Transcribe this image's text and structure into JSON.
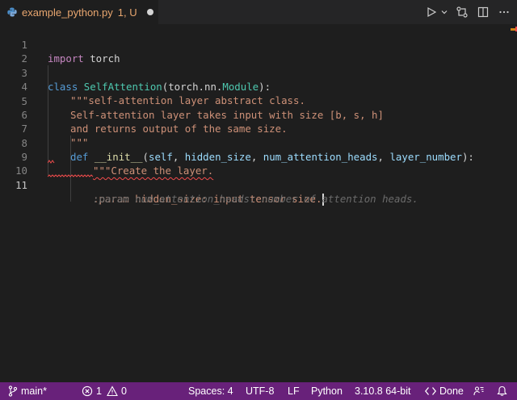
{
  "tab": {
    "filename": "example_python.py",
    "status": "1, U"
  },
  "editor": {
    "lines": [
      {
        "num": "1"
      },
      {
        "num": "2"
      },
      {
        "num": "3"
      },
      {
        "num": "4"
      },
      {
        "num": "5"
      },
      {
        "num": "6"
      },
      {
        "num": "7"
      },
      {
        "num": "8"
      },
      {
        "num": "9"
      },
      {
        "num": "10"
      },
      {
        "num": "11"
      }
    ],
    "code": {
      "l1_kw": "import",
      "l1_rest": " torch",
      "l3_kw": "class",
      "l3_cls": "SelfAttention",
      "l3_rest1": "(torch.nn.",
      "l3_base": "Module",
      "l3_rest2": "):",
      "l4": "\"\"\"self-attention layer abstract class.",
      "l5": "Self-attention layer takes input with size [b, s, h]",
      "l6": "and returns output of the same size.",
      "l7": "\"\"\"",
      "l8_kw": "def",
      "l8_fn": "__init__",
      "l8_open": "(",
      "l8_p1": "self",
      "l8_p2": "hidden_size",
      "l8_p3": "num_attention_heads",
      "l8_p4": "layer_number",
      "l8_close": "):",
      "l8_comma": ", ",
      "l9": "\"\"\"Create the layer.",
      "l11": ":param hidden_size: input tensor size.",
      "ghost": ":param num_attention_heads: number of attention heads."
    }
  },
  "statusbar": {
    "branch": "main*",
    "errors": "1",
    "warnings": "0",
    "spaces": "Spaces: 4",
    "encoding": "UTF-8",
    "eol": "LF",
    "language": "Python",
    "interpreter": "3.10.8 64-bit",
    "done": "Done"
  },
  "colors": {
    "statusbar": "#68217a",
    "tab_modified": "#e8a66f",
    "error": "#f14c4c"
  }
}
